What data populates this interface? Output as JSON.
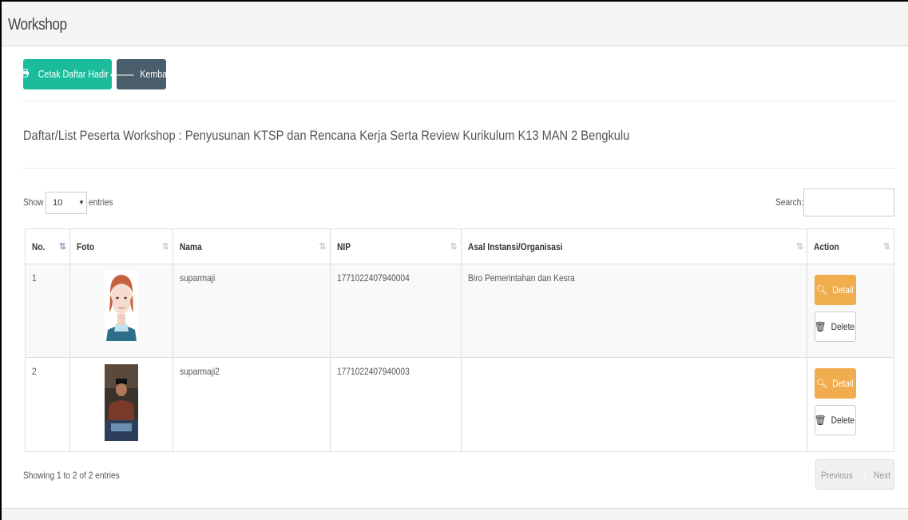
{
  "panel": {
    "title": "Workshop"
  },
  "toolbar": {
    "print_label": "Cetak Daftar Hadir",
    "back_label": "Kembali",
    "print_icon": "printer-icon",
    "back_icon": "arrow-left-icon",
    "print_color": "#1abc9c",
    "back_color": "#4a5d6b"
  },
  "list_title": "Daftar/List Peserta Workshop : Penyusunan KTSP dan Rencana Kerja Serta Review Kurikulum K13 MAN 2 Bengkulu",
  "length": {
    "show_label": "Show",
    "selected": "10",
    "entries_label": "entries"
  },
  "search": {
    "label": "Search:",
    "value": "",
    "placeholder": ""
  },
  "table": {
    "columns": [
      "No.",
      "Foto",
      "Nama",
      "NIP",
      "Asal Instansi/Organisasi",
      "Action"
    ],
    "rows": [
      {
        "no": "1",
        "nama": "suparmaji",
        "nip": "1771022407940004",
        "instansi": "Biro Pemerintahan dan Kesra"
      },
      {
        "no": "2",
        "nama": "suparmaji2",
        "nip": "1771022407940003",
        "instansi": ""
      }
    ],
    "detail_label": "Detail",
    "delete_label": "Delete",
    "detail_color": "#f0ad4e"
  },
  "footer": {
    "info": "Showing 1 to 2 of 2 entries",
    "prev": "Previous",
    "current": "1",
    "next": "Next"
  }
}
